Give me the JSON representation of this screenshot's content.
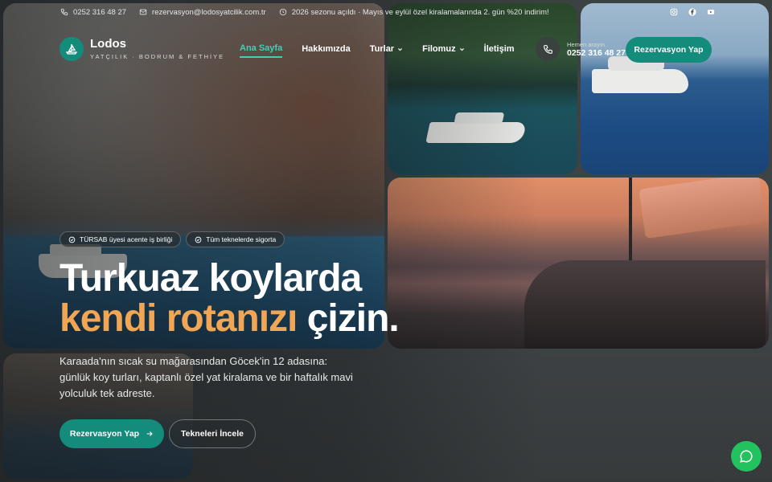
{
  "topbar": {
    "phone": "0252 316 48 27",
    "email": "rezervasyon@lodosyatcilik.com.tr",
    "notice": "2026 sezonu açıldı · Mayıs ve eylül özel kiralamalarında 2. gün %20 indirim!",
    "socials": [
      "instagram-icon",
      "facebook-icon",
      "youtube-icon"
    ]
  },
  "brand": {
    "name": "Lodos",
    "tagline": "YATÇILIK · BODRUM & FETHİYE"
  },
  "nav": [
    {
      "label": "Ana Sayfa",
      "active": true
    },
    {
      "label": "Hakkımızda"
    },
    {
      "label": "Turlar",
      "dropdown": true
    },
    {
      "label": "Filomuz",
      "dropdown": true
    },
    {
      "label": "İletişim"
    }
  ],
  "header_phone": {
    "label": "Hemen arayın",
    "number": "0252 316 48 27"
  },
  "header_cta": "Rezervasyon Yap",
  "hero": {
    "badges": [
      "TÜRSAB üyesi acente iş birliği",
      "Tüm teknelerde sigorta"
    ],
    "title_line1": "Turkuaz koylarda",
    "title_accent": "kendi rotanızı",
    "title_end": "çizin.",
    "lead": "Karaada'nın sıcak su mağarasından Göcek'in 12 adasına: günlük koy turları, kaptanlı özel yat kiralama ve bir haftalık mavi yolculuk tek adreste.",
    "primary_cta": "Rezervasyon Yap",
    "secondary_cta": "Tekneleri İncele"
  },
  "colors": {
    "accent": "#138c7c",
    "highlight": "#f0a655",
    "active_nav": "#3fd1b8",
    "chat": "#22c35e"
  }
}
